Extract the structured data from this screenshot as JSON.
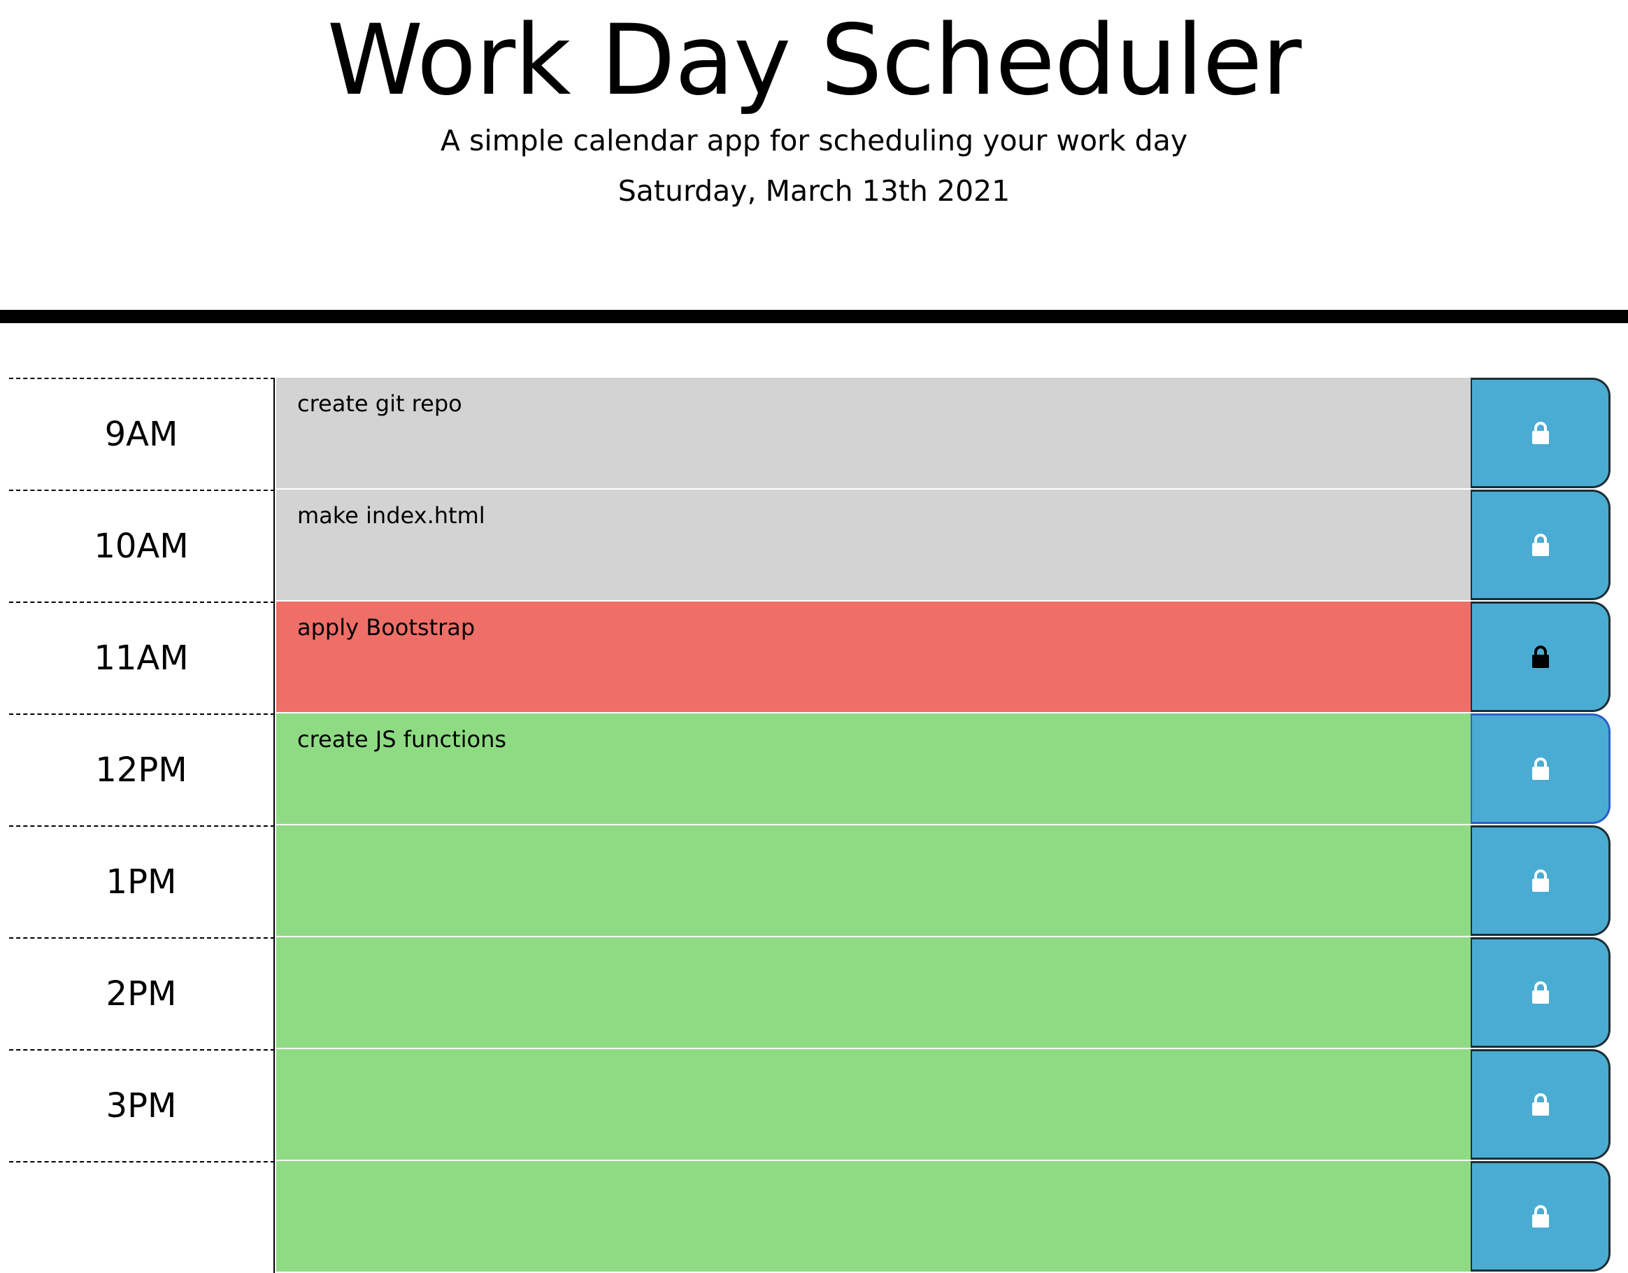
{
  "header": {
    "title": "Work Day Scheduler",
    "lead": "A simple calendar app for scheduling your work day",
    "current_day": "Saturday, March 13th 2021"
  },
  "colors": {
    "past": "#d3d3d3",
    "present": "#ef6f68",
    "future": "#8fdb84",
    "save_button": "#4bacd3"
  },
  "time_blocks": [
    {
      "hour": "9AM",
      "text": "create git repo",
      "state": "past",
      "icon": "lock-icon"
    },
    {
      "hour": "10AM",
      "text": "make index.html",
      "state": "past",
      "icon": "lock-icon"
    },
    {
      "hour": "11AM",
      "text": "apply Bootstrap",
      "state": "present",
      "icon": "lock-icon"
    },
    {
      "hour": "12PM",
      "text": "create JS functions",
      "state": "future",
      "icon": "lock-icon"
    },
    {
      "hour": "1PM",
      "text": "",
      "state": "future",
      "icon": "lock-icon"
    },
    {
      "hour": "2PM",
      "text": "",
      "state": "future",
      "icon": "lock-icon"
    },
    {
      "hour": "3PM",
      "text": "",
      "state": "future",
      "icon": "lock-icon"
    },
    {
      "hour": "",
      "text": "",
      "state": "future",
      "icon": "lock-icon"
    }
  ]
}
